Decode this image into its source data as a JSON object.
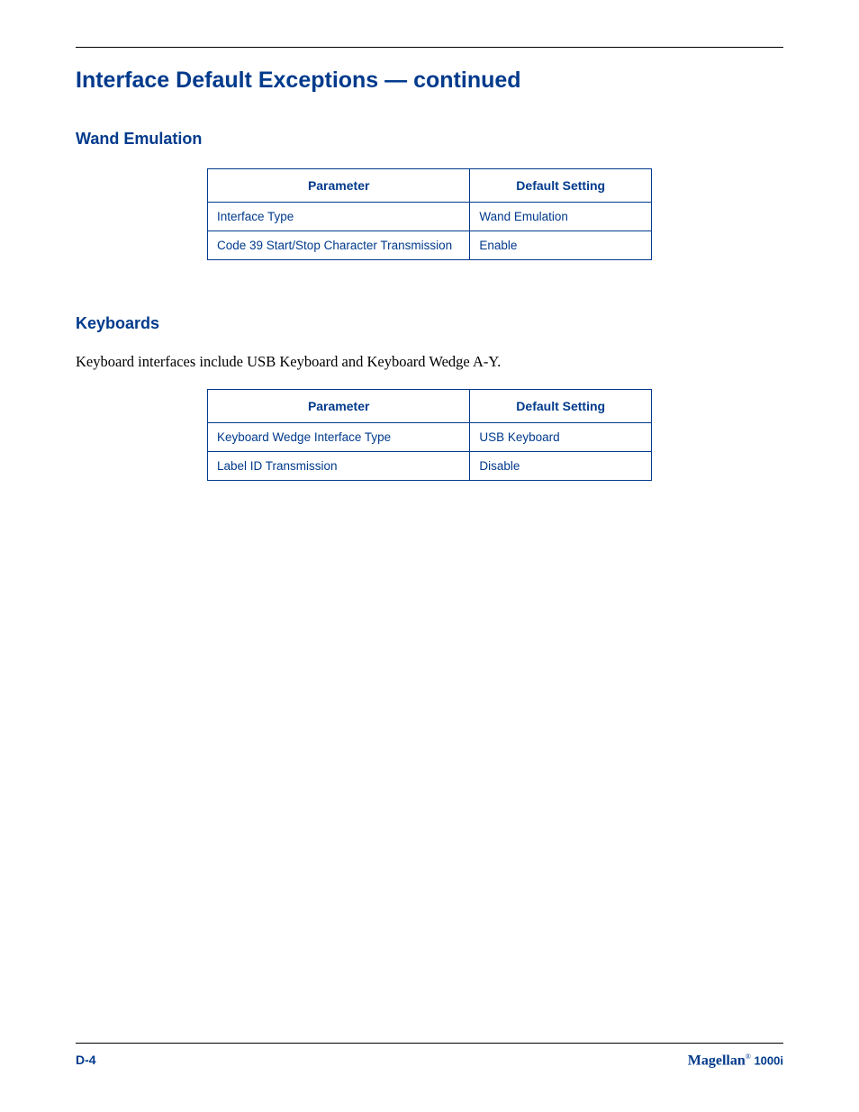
{
  "page_title": "Interface Default Exceptions — continued",
  "sections": [
    {
      "heading": "Wand Emulation",
      "body": "",
      "table": {
        "headers": {
          "param": "Parameter",
          "default": "Default Setting"
        },
        "rows": [
          {
            "param": "Interface Type",
            "default": "Wand Emulation"
          },
          {
            "param": "Code 39 Start/Stop Character Transmission",
            "default": "Enable"
          }
        ]
      }
    },
    {
      "heading": "Keyboards",
      "body": "Keyboard interfaces include USB Keyboard and Keyboard Wedge A-Y.",
      "table": {
        "headers": {
          "param": "Parameter",
          "default": "Default Setting"
        },
        "rows": [
          {
            "param": "Keyboard Wedge Interface Type",
            "default": "USB Keyboard"
          },
          {
            "param": "Label ID Transmission",
            "default": "Disable"
          }
        ]
      }
    }
  ],
  "footer": {
    "page_number": "D-4",
    "brand_name": "Magellan",
    "brand_reg": "®",
    "brand_model": " 1000i"
  }
}
